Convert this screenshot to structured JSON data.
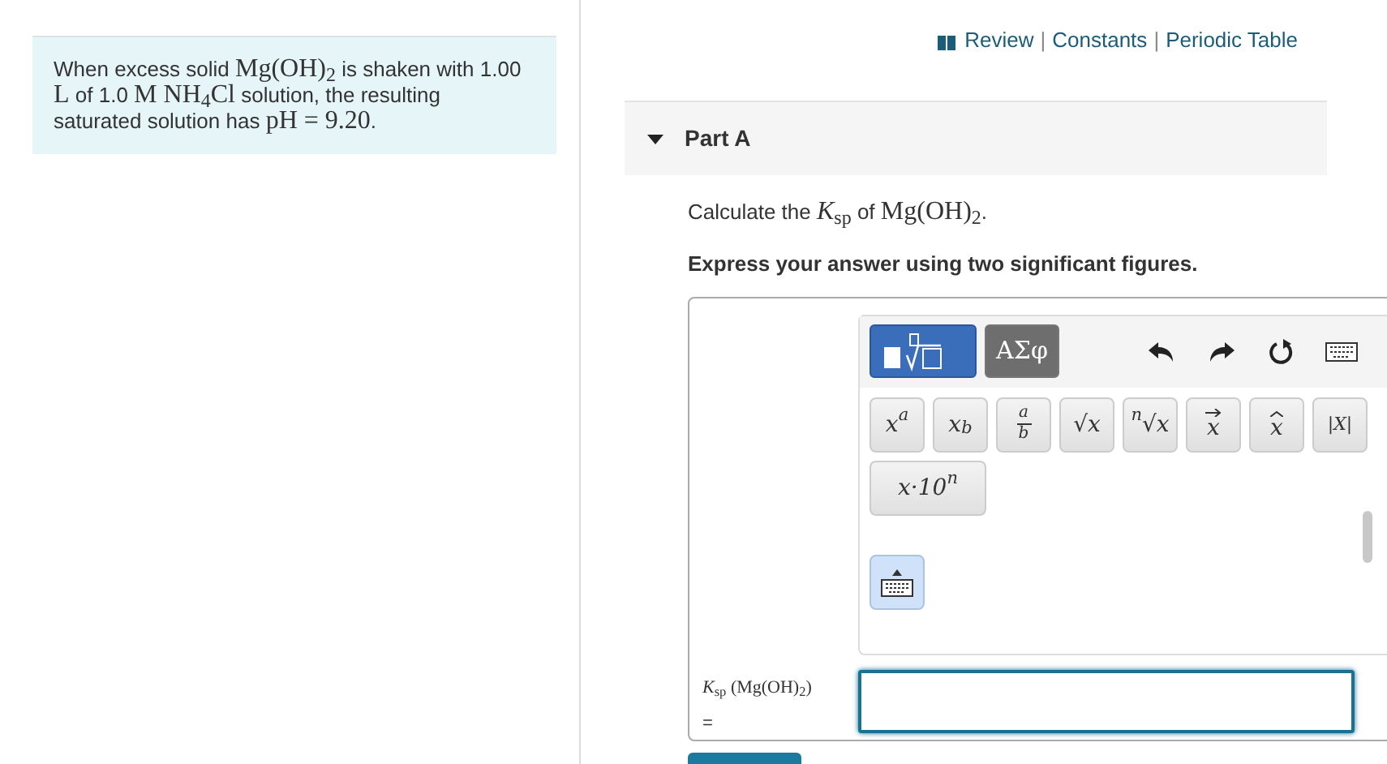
{
  "problem": {
    "segments": [
      {
        "text": "When excess solid ",
        "math": false
      },
      {
        "text": "Mg(OH)$_{2}$",
        "math": true
      },
      {
        "text": " is shaken with 1.00 ",
        "math": false
      },
      {
        "text": "L",
        "math": true
      },
      {
        "text": " of 1.0 ",
        "math": false
      },
      {
        "text": "M NH$_{4}$Cl",
        "math": true
      },
      {
        "text": " solution, the resulting saturated solution has ",
        "math": false
      },
      {
        "text": "pH = 9.20",
        "math": true
      },
      {
        "text": ".",
        "math": false
      }
    ]
  },
  "resource_links": [
    {
      "kind": "link",
      "text": "Review"
    },
    {
      "kind": "separator",
      "text": "|"
    },
    {
      "kind": "link",
      "text": "Constants"
    },
    {
      "kind": "separator",
      "text": "|"
    },
    {
      "kind": "link",
      "text": "Periodic Table"
    }
  ],
  "part": {
    "title": "Part A",
    "expanded": true,
    "question": [
      {
        "text": "Calculate the ",
        "math": false
      },
      {
        "text": "*K*$_{sp}$",
        "math": true
      },
      {
        "text": " of ",
        "math": false
      },
      {
        "text": "Mg(OH)$_{2}$",
        "math": true
      },
      {
        "text": ".",
        "math": false
      }
    ],
    "instruction": "Express your answer using two significant figures.",
    "modes": [
      {
        "kind": "templates",
        "selected": true
      },
      {
        "kind": "symbols",
        "label": "ΑΣφ",
        "selected": false
      }
    ],
    "tools": [
      {
        "kind": "undo"
      },
      {
        "kind": "redo"
      },
      {
        "kind": "reset"
      },
      {
        "kind": "keyboard"
      }
    ],
    "templates": [
      {
        "kind": "sup",
        "base": "x",
        "script": "a"
      },
      {
        "kind": "sub",
        "base": "x",
        "script": "b"
      },
      {
        "kind": "fraction",
        "base": "a",
        "script": "b"
      },
      {
        "kind": "root",
        "base": "√x"
      },
      {
        "kind": "nroot",
        "base": "√x",
        "script": "n"
      },
      {
        "kind": "vector",
        "base": "x"
      },
      {
        "kind": "hat",
        "base": "x"
      },
      {
        "kind": "abs",
        "base": "|X|"
      },
      {
        "kind": "sci",
        "base": "x·10",
        "script": "n"
      }
    ],
    "answer_label": "*K*$_{sp}$ (Mg(OH)$_{2}$)",
    "answer_equals": "="
  }
}
